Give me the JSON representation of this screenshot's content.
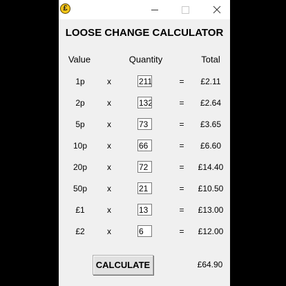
{
  "window": {
    "icon_glyph": "£",
    "icon_name": "pound-coin-icon",
    "title": "LOOSE CHANGE CALCULATOR"
  },
  "headers": {
    "value": "Value",
    "quantity": "Quantity",
    "total": "Total"
  },
  "multiply_symbol": "x",
  "equals_symbol": "=",
  "rows": [
    {
      "value": "1p",
      "quantity": "211",
      "total": "£2.11"
    },
    {
      "value": "2p",
      "quantity": "132",
      "total": "£2.64"
    },
    {
      "value": "5p",
      "quantity": "73",
      "total": "£3.65"
    },
    {
      "value": "10p",
      "quantity": "66",
      "total": "£6.60"
    },
    {
      "value": "20p",
      "quantity": "72",
      "total": "£14.40"
    },
    {
      "value": "50p",
      "quantity": "21",
      "total": "£10.50"
    },
    {
      "value": "£1",
      "quantity": "13",
      "total": "£13.00"
    },
    {
      "value": "£2",
      "quantity": "6",
      "total": "£12.00"
    }
  ],
  "calculate_label": "CALCULATE",
  "grand_total": "£64.90"
}
